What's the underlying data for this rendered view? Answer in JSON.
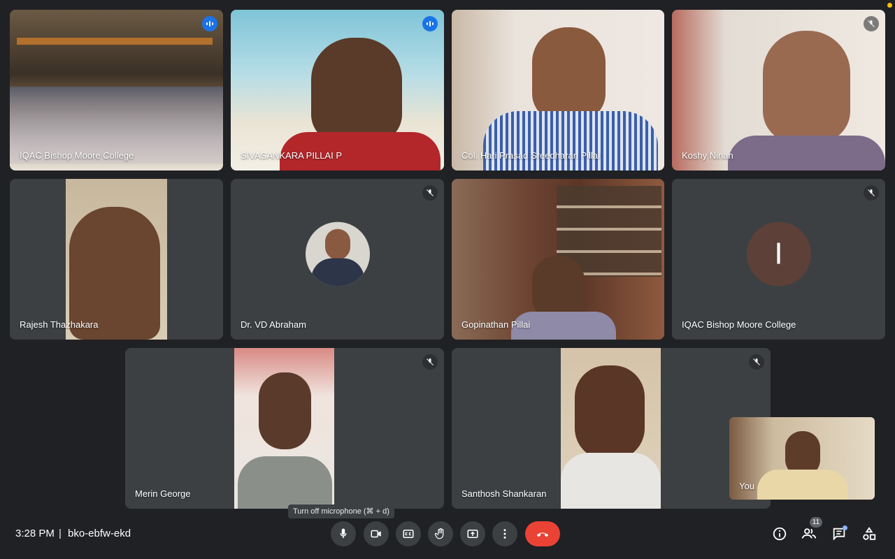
{
  "meeting": {
    "time": "3:28 PM",
    "separator": "|",
    "code": "bko-ebfw-ekd"
  },
  "participants": [
    {
      "name": "IQAC Bishop Moore College"
    },
    {
      "name": "SIVASANKARA PILLAI P"
    },
    {
      "name": "Col. Hari Prasad Sreedharan Pillai"
    },
    {
      "name": "Koshy Ninan"
    },
    {
      "name": "Rajesh Thazhakara"
    },
    {
      "name": "Dr. VD Abraham"
    },
    {
      "name": "Gopinathan Pillai"
    },
    {
      "name": "IQAC Bishop Moore College",
      "avatar_letter": "I"
    },
    {
      "name": "Merin George"
    },
    {
      "name": "Santhosh Shankaran"
    }
  ],
  "self_view": {
    "label": "You"
  },
  "tooltip": "Turn off microphone (⌘ + d)",
  "people_count": "11",
  "controls": [
    "microphone-icon",
    "camera-icon",
    "captions-icon",
    "raise-hand-icon",
    "present-icon",
    "more-options-icon",
    "end-call-icon"
  ],
  "right_icons": [
    "info-icon",
    "people-icon",
    "chat-icon",
    "activities-icon"
  ],
  "colors": {
    "background": "#202124",
    "tile": "#3c4043",
    "accent": "#1a73e8",
    "end_call": "#ea4335",
    "letter_avatar": "#5d4037"
  }
}
